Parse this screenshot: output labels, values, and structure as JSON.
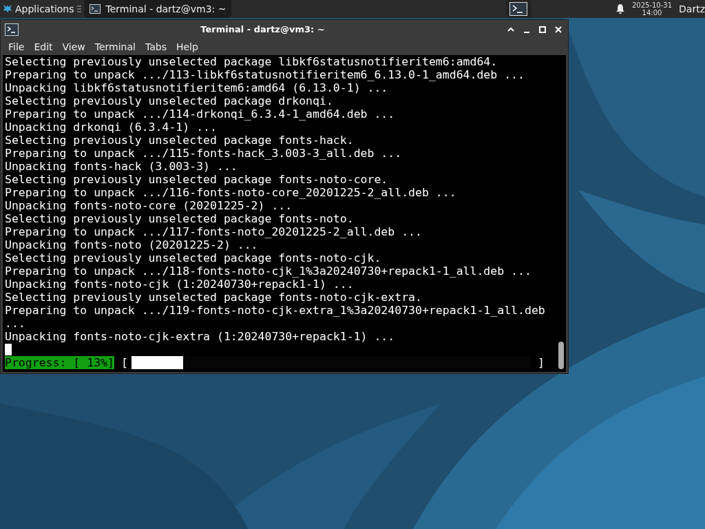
{
  "panel": {
    "applications": "Applications",
    "tasks": [
      {
        "title": "Terminal - dartz@vm3: ~",
        "selected": true
      }
    ],
    "clock": {
      "date": "2025-10-31",
      "time": "14:00"
    },
    "user": "Dartz"
  },
  "window": {
    "title": "Terminal - dartz@vm3: ~",
    "menu": [
      "File",
      "Edit",
      "View",
      "Terminal",
      "Tabs",
      "Help"
    ]
  },
  "terminal": {
    "lines": [
      "Selecting previously unselected package libkf6statusnotifieritem6:amd64.",
      "Preparing to unpack .../113-libkf6statusnotifieritem6_6.13.0-1_amd64.deb ...",
      "Unpacking libkf6statusnotifieritem6:amd64 (6.13.0-1) ...",
      "Selecting previously unselected package drkonqi.",
      "Preparing to unpack .../114-drkonqi_6.3.4-1_amd64.deb ...",
      "Unpacking drkonqi (6.3.4-1) ...",
      "Selecting previously unselected package fonts-hack.",
      "Preparing to unpack .../115-fonts-hack_3.003-3_all.deb ...",
      "Unpacking fonts-hack (3.003-3) ...",
      "Selecting previously unselected package fonts-noto-core.",
      "Preparing to unpack .../116-fonts-noto-core_20201225-2_all.deb ...",
      "Unpacking fonts-noto-core (20201225-2) ...",
      "Selecting previously unselected package fonts-noto.",
      "Preparing to unpack .../117-fonts-noto_20201225-2_all.deb ...",
      "Unpacking fonts-noto (20201225-2) ...",
      "Selecting previously unselected package fonts-noto-cjk.",
      "Preparing to unpack .../118-fonts-noto-cjk_1%3a20240730+repack1-1_all.deb ...",
      "Unpacking fonts-noto-cjk (1:20240730+repack1-1) ...",
      "Selecting previously unselected package fonts-noto-cjk-extra.",
      "Preparing to unpack .../119-fonts-noto-cjk-extra_1%3a20240730+repack1-1_all.deb",
      "...",
      "Unpacking fonts-noto-cjk-extra (1:20240730+repack1-1) ..."
    ],
    "progress": {
      "label": "Progress: [ 13%]",
      "open": "[",
      "close": "]",
      "level": 0.13
    }
  }
}
